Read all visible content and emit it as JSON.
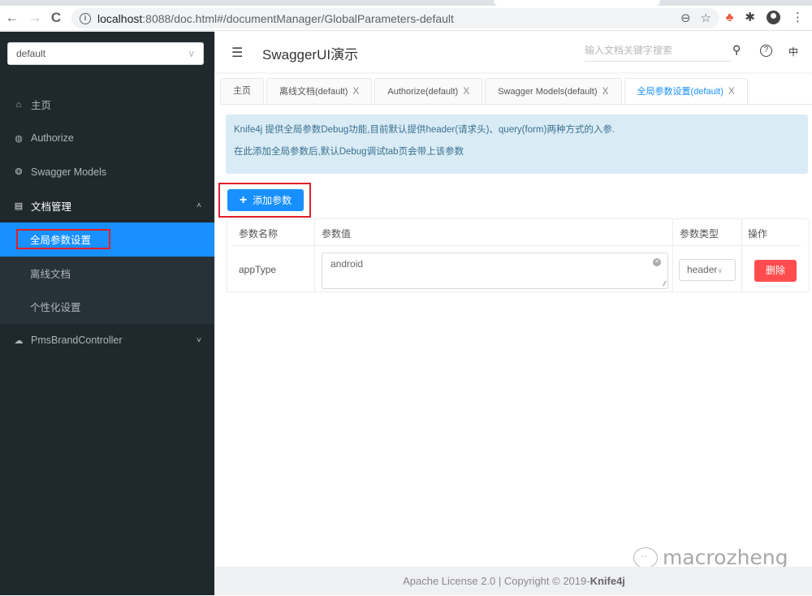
{
  "browser": {
    "url_host": "localhost",
    "url_rest": ":8088/doc.html#/documentManager/GlobalParameters-default",
    "back_icon": "←",
    "forward_icon": "→",
    "reload_icon": "C",
    "info_icon": "i",
    "zoom_icon": "⊖",
    "star_icon": "☆",
    "ext_icon": "♣",
    "puzzle_icon": "✱",
    "menu_icon": "⋮"
  },
  "sidebar": {
    "group_select": {
      "value": "default",
      "chevron": "∨"
    },
    "items": [
      {
        "label": "主页",
        "icon": "⌂"
      },
      {
        "label": "Authorize",
        "icon": "◍"
      },
      {
        "label": "Swagger Models",
        "icon": "❂"
      },
      {
        "label": "文档管理",
        "icon": "▤",
        "arrow": "˄"
      }
    ],
    "submenu": [
      {
        "label": "全局参数设置"
      },
      {
        "label": "离线文档"
      },
      {
        "label": "个性化设置"
      }
    ],
    "controller": {
      "label": "PmsBrandController",
      "icon": "☁",
      "arrow": "˅"
    }
  },
  "header": {
    "fold_icon": "☰",
    "title": "SwaggerUI演示",
    "search_placeholder": "输入文档关键字搜索",
    "search_icon": "⚲",
    "help_icon": "?",
    "lang": "中"
  },
  "tabs": [
    {
      "label": "主页",
      "closable": false
    },
    {
      "label": "离线文档(default)",
      "close": "X"
    },
    {
      "label": "Authorize(default)",
      "close": "X"
    },
    {
      "label": "Swagger Models(default)",
      "close": "X"
    },
    {
      "label": "全局参数设置(default)",
      "close": "X",
      "active": true
    }
  ],
  "alert": {
    "line1": "Knife4j 提供全局参数Debug功能,目前默认提供header(请求头)、query(form)两种方式的入参.",
    "line2": "在此添加全局参数后,默认Debug调试tab页会带上该参数"
  },
  "add_button": {
    "plus": "+",
    "label": "添加参数"
  },
  "table": {
    "headers": [
      "参数名称",
      "参数值",
      "参数类型",
      "操作"
    ],
    "rows": [
      {
        "name": "appType",
        "value": "android",
        "type": "header",
        "type_chevron": "∨",
        "action": "删除"
      }
    ]
  },
  "footer": {
    "text": "Apache License 2.0 | Copyright © 2019-",
    "brand": "Knife4j"
  },
  "watermark": "macrozheng"
}
